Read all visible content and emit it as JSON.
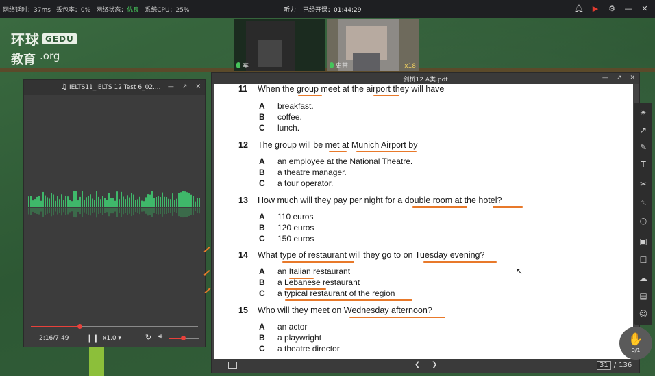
{
  "topbar": {
    "latency": "网络延时：37ms",
    "packet_loss": "丢包率：0%",
    "net_state_label": "网络状态：",
    "net_state_value": "优良",
    "cpu": "系统CPU：25%",
    "mode": "听力",
    "class_timer": "已经开课：01:44:29"
  },
  "logo": {
    "line1": "环球",
    "badge": "GEDU",
    "line2": "教育",
    "domain": ".org"
  },
  "videos": [
    {
      "name": "车",
      "blurred": true
    },
    {
      "name": "史蒂",
      "count": "x18",
      "blurred": true
    }
  ],
  "player": {
    "title": "IELTS11_IELTS 12 Test 6_02....",
    "progress": 0.29,
    "time": "2:16/7:49",
    "speed": "x1.0",
    "volume": 0.45
  },
  "pdf": {
    "title": "剑桥12 A类.pdf",
    "current_page": "31",
    "page_separator": "/",
    "total_pages": "136",
    "questions": [
      {
        "num": "11",
        "text": "When the group meet at the airport they will have",
        "options": [
          {
            "letter": "A",
            "text": "breakfast."
          },
          {
            "letter": "B",
            "text": "coffee."
          },
          {
            "letter": "C",
            "text": "lunch."
          }
        ]
      },
      {
        "num": "12",
        "text": "The group will be met at Munich Airport by",
        "options": [
          {
            "letter": "A",
            "text": "an employee at the National Theatre."
          },
          {
            "letter": "B",
            "text": "a theatre manager."
          },
          {
            "letter": "C",
            "text": "a tour operator."
          }
        ]
      },
      {
        "num": "13",
        "text": "How much will they pay per night for a double room at the hotel?",
        "options": [
          {
            "letter": "A",
            "text": "110 euros"
          },
          {
            "letter": "B",
            "text": "120 euros"
          },
          {
            "letter": "C",
            "text": "150 euros"
          }
        ]
      },
      {
        "num": "14",
        "text": "What type of restaurant will they go to on Tuesday evening?",
        "options": [
          {
            "letter": "A",
            "text": "an Italian restaurant"
          },
          {
            "letter": "B",
            "text": "a Lebanese restaurant"
          },
          {
            "letter": "C",
            "text": "a typical restaurant of the region"
          }
        ]
      },
      {
        "num": "15",
        "text": "Who will they meet on Wednesday afternoon?",
        "options": [
          {
            "letter": "A",
            "text": "an actor"
          },
          {
            "letter": "B",
            "text": "a playwright"
          },
          {
            "letter": "C",
            "text": "a theatre director"
          }
        ]
      }
    ]
  },
  "raise_hand": {
    "count": "0/1"
  },
  "colors": {
    "accent_red": "#e8413b",
    "annotation_orange": "#e8792a",
    "status_good": "#46c45a"
  }
}
